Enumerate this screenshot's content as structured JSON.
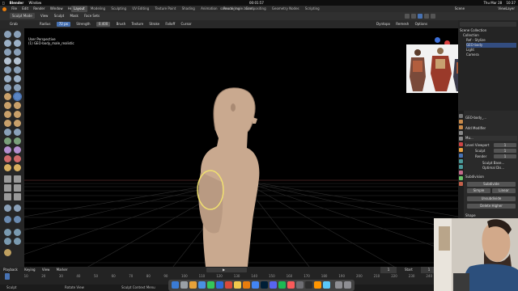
{
  "mac_menubar": {
    "app_name": "Blender",
    "window_menu": "Window",
    "center_clock": "00:01:57",
    "right_items": [
      "Thu Mar 28",
      "10:37"
    ]
  },
  "topbar": {
    "menus": [
      "File",
      "Edit",
      "Render",
      "Window",
      "Help"
    ],
    "workspace_tabs": [
      {
        "label": "Layout",
        "active": true
      },
      {
        "label": "Modeling",
        "active": false
      },
      {
        "label": "Sculpting",
        "active": false
      },
      {
        "label": "UV Editing",
        "active": false
      },
      {
        "label": "Texture Paint",
        "active": false
      },
      {
        "label": "Shading",
        "active": false
      },
      {
        "label": "Animation",
        "active": false
      },
      {
        "label": "Rendering",
        "active": false
      },
      {
        "label": "Compositing",
        "active": false
      },
      {
        "label": "Geometry Nodes",
        "active": false
      },
      {
        "label": "Scripting",
        "active": false
      }
    ],
    "file_title": "samurai_male.blend",
    "scene_label": "Scene",
    "view_layer_label": "ViewLayer"
  },
  "header": {
    "mode": "Sculpt Mode",
    "menus": [
      "View",
      "Sculpt",
      "Mask",
      "Face Sets"
    ],
    "right_items": [
      "Dyntopo",
      "Remesh",
      "Options"
    ]
  },
  "tool_settings": {
    "brush": "Grab",
    "radius_label": "Radius",
    "radius_value": "72 px",
    "strength_label": "Strength",
    "strength_value": "0.400",
    "menus": [
      "Brush",
      "Texture",
      "Stroke",
      "Falloff",
      "Cursor"
    ],
    "right_items": [
      "Dyntopo",
      "Remesh",
      "Options"
    ]
  },
  "viewport": {
    "view_name": "User Perspective",
    "object_name": "(1) GEO-body_male_realistic",
    "brush_cursor_color": "#f0e070"
  },
  "outliner": {
    "rows": [
      {
        "label": "Scene Collection",
        "selected": false
      },
      {
        "label": "Collection",
        "selected": false
      },
      {
        "label": "Ref - Stylize",
        "selected": false
      },
      {
        "label": "GEO-body",
        "selected": true
      },
      {
        "label": "Light",
        "selected": false
      },
      {
        "label": "Camera",
        "selected": false
      }
    ]
  },
  "properties": {
    "object_name": "GEO-body_...",
    "add_modifier": "Add Modifier",
    "modifier_name": "Mu...",
    "fields": [
      {
        "label": "Level Viewport",
        "value": "1"
      },
      {
        "label": "Sculpt",
        "value": "1"
      },
      {
        "label": "Render",
        "value": "1"
      }
    ],
    "sculpt_base_mesh": "Sculpt Base...",
    "optimal_display": "Optimal Dis...",
    "subdivision_header": "Subdivision",
    "subdivide_button": "Subdivide",
    "simple_button": "Simple",
    "linear_button": "Linear",
    "unsubdivide_button": "Unsubdivide",
    "delete_higher_button": "Delete Higher",
    "shape_header": "Shape",
    "reshape_button": "Reshape",
    "apply_base_button": "Apply Base",
    "generate_header": "Generate",
    "advanced_header": "Advanced"
  },
  "timeline": {
    "menus": [
      "Playback",
      "Keying",
      "View",
      "Marker"
    ],
    "current_frame": "1",
    "start_label": "Start",
    "start_value": "1",
    "ruler_ticks": [
      "1",
      "10",
      "20",
      "30",
      "40",
      "50",
      "60",
      "70",
      "80",
      "90",
      "100",
      "110",
      "120",
      "130",
      "140",
      "150",
      "160",
      "170",
      "180",
      "190",
      "200",
      "210",
      "220",
      "230",
      "240",
      "250"
    ]
  },
  "statusbar": {
    "items": [
      "Sculpt",
      "Rotate View",
      "Sculpt Context Menu"
    ]
  },
  "colors": {
    "accent": "#4772b3",
    "selected_row": "#334d80",
    "blender_orange": "#e87d0d",
    "skin": "#c9a98f"
  }
}
